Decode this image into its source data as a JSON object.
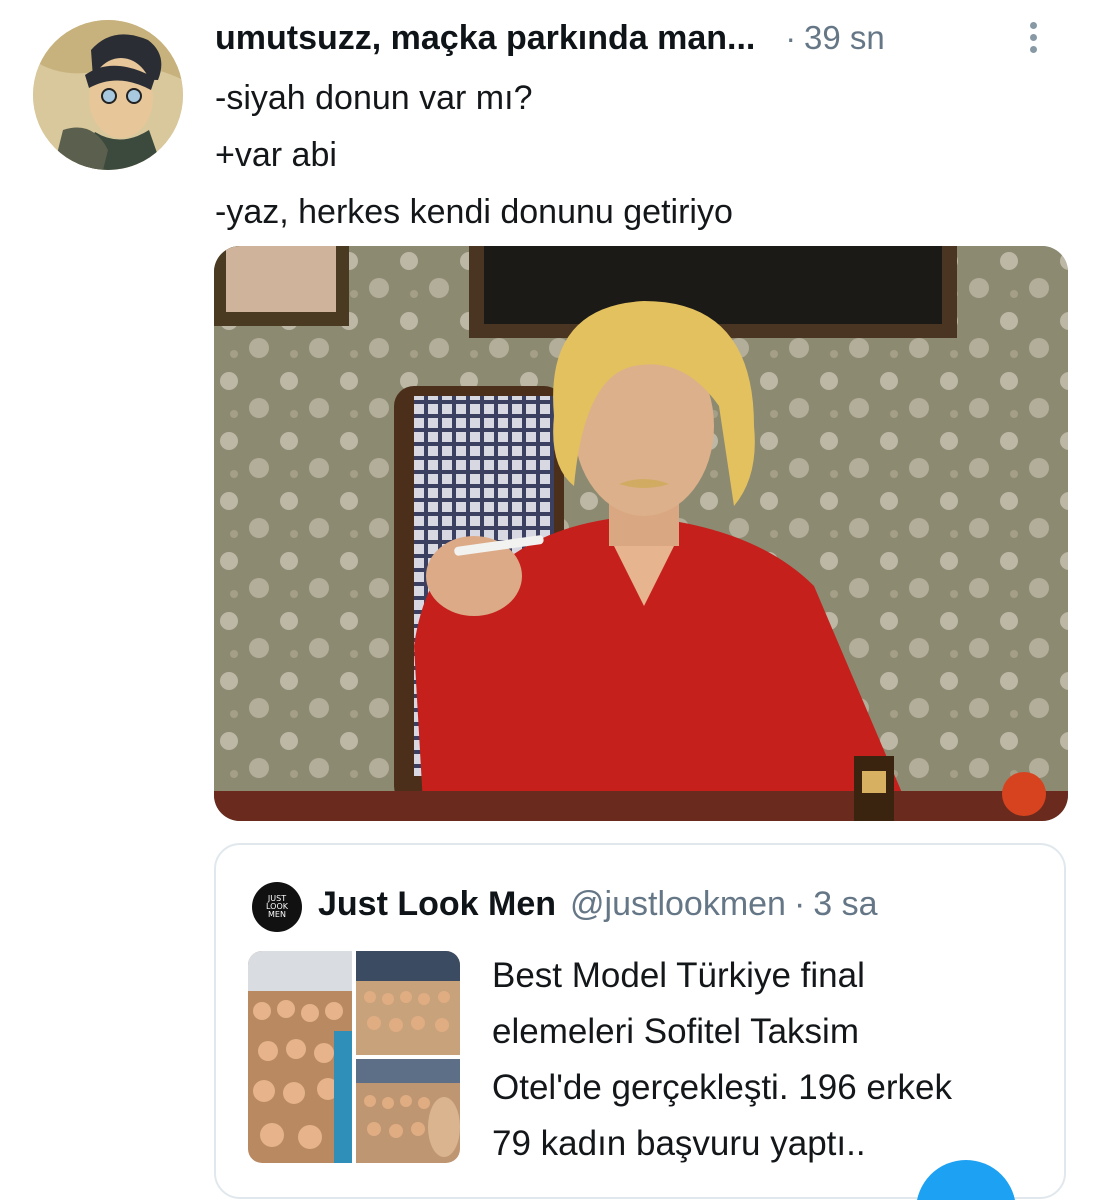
{
  "tweet": {
    "display_name": "umutsuzz, maçka parkında man...",
    "separator": "·",
    "time": "39 sn",
    "text_lines": [
      "-siyah donun var mı?",
      "+var abi",
      "-yaz, herkes kendi donunu getiriyo"
    ]
  },
  "quote": {
    "avatar_lines": [
      "JUST",
      "LOOK",
      "MEN"
    ],
    "name": "Just Look Men",
    "handle": "@justlookmen",
    "separator": "·",
    "time": "3 sa",
    "text_lines": [
      "Best Model Türkiye final",
      "elemeleri Sofitel Taksim",
      "Otel'de gerçekleşti. 196 erkek",
      "79 kadın başvuru yaptı.."
    ]
  },
  "colors": {
    "accent": "#1da1f2",
    "secondary_text": "#657786",
    "border": "#e1e8ed"
  },
  "icons": [
    "more-vertical-icon",
    "compose-icon"
  ]
}
